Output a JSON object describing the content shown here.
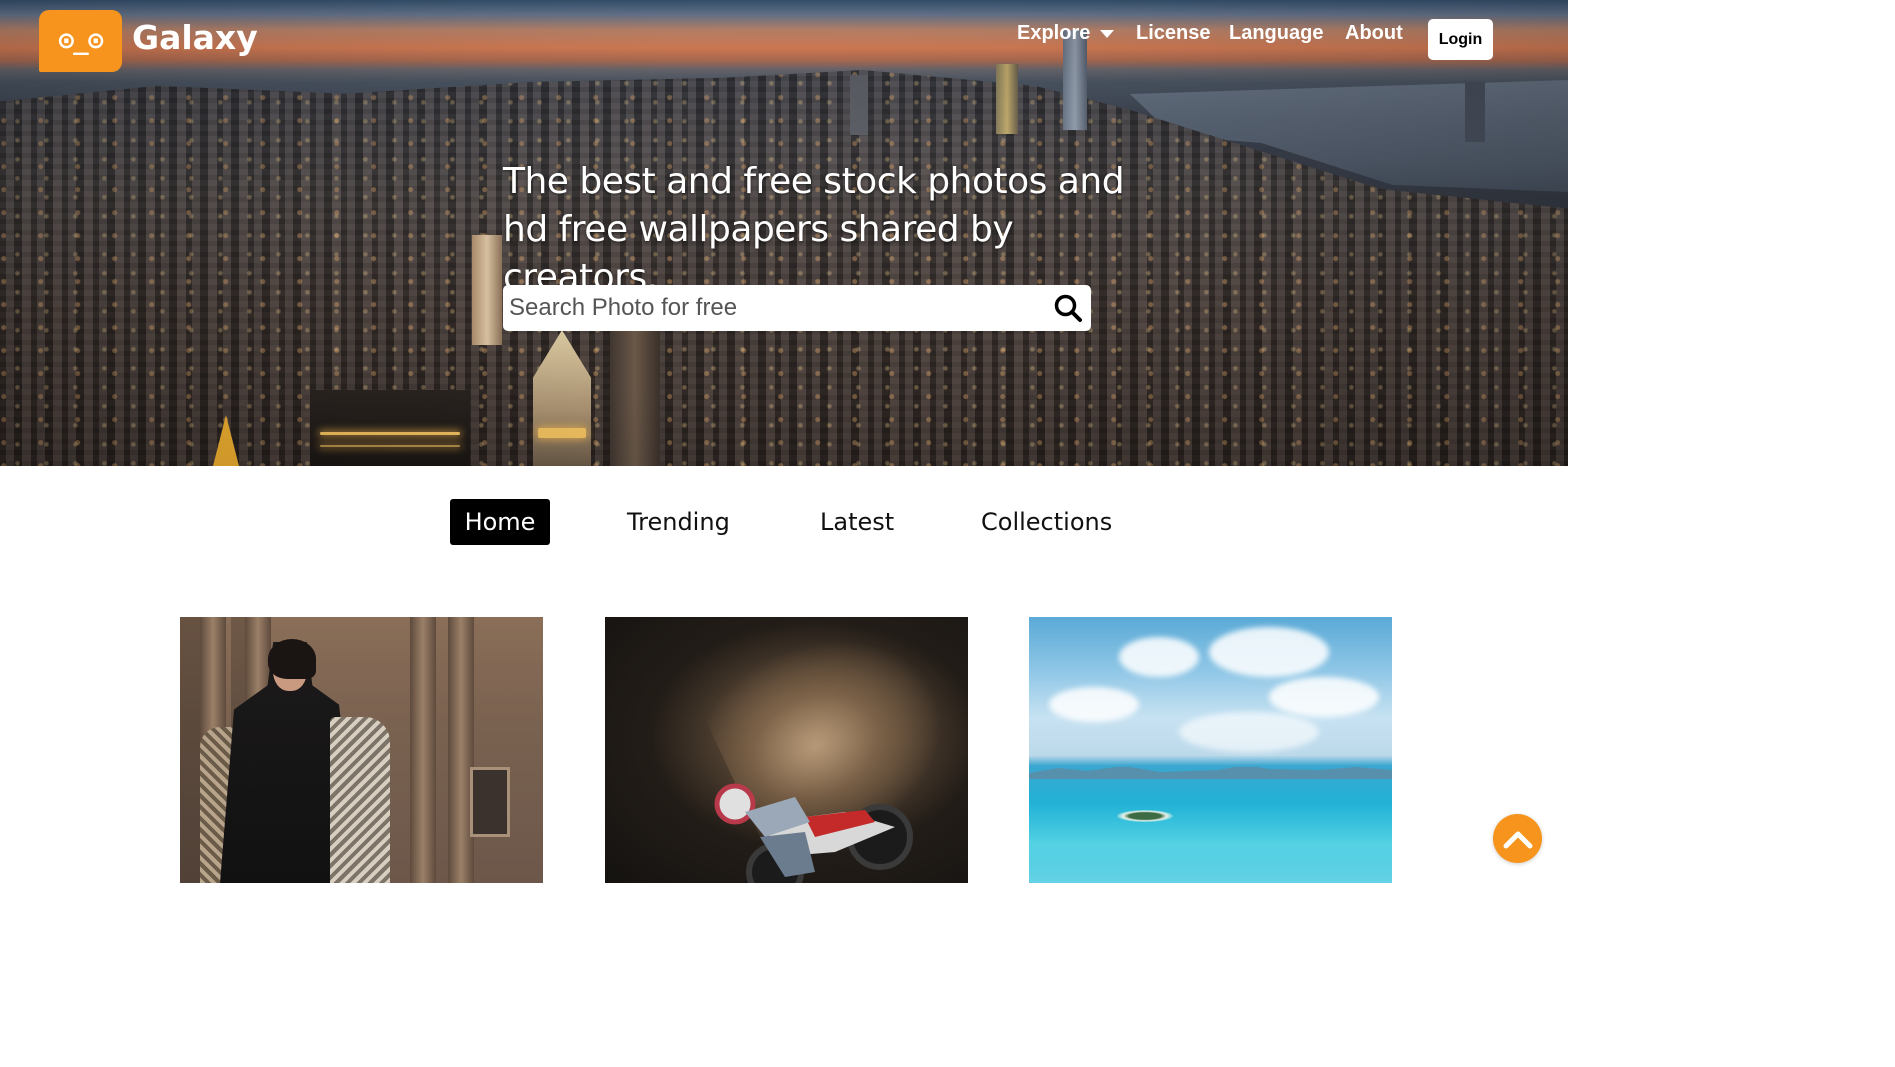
{
  "brand": {
    "logo_text": "⊙_⊙",
    "name": "Galaxy",
    "accent_color": "#f7941d"
  },
  "nav": {
    "explore": "Explore",
    "explore_icon": "caret-down-icon",
    "license": "License",
    "language": "Language",
    "about": "About",
    "login": "Login"
  },
  "hero": {
    "headline": "The best and free stock photos and hd free wallpapers shared by creators.",
    "search": {
      "placeholder": "Search Photo for free",
      "value": "",
      "icon": "search-icon"
    }
  },
  "tabs": [
    {
      "label": "Home",
      "active": true
    },
    {
      "label": "Trending",
      "active": false
    },
    {
      "label": "Latest",
      "active": false
    },
    {
      "label": "Collections",
      "active": false
    }
  ],
  "gallery": {
    "photos": [
      {
        "subject": "woman in black sweater and embroidered coat"
      },
      {
        "subject": "motocross rider kicking up dust"
      },
      {
        "subject": "tropical sea with small island"
      }
    ]
  },
  "scroll_top": {
    "icon": "chevron-up-icon"
  }
}
